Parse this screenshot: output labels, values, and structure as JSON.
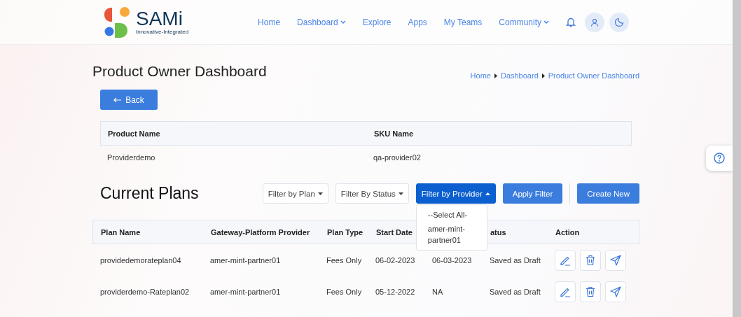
{
  "brand": {
    "name": "SAMi",
    "tagline": "Innovative-Integrated"
  },
  "nav": [
    {
      "label": "Home",
      "dropdown": false
    },
    {
      "label": "Dashboard",
      "dropdown": true
    },
    {
      "label": "Explore",
      "dropdown": false
    },
    {
      "label": "Apps",
      "dropdown": false
    },
    {
      "label": "My Teams",
      "dropdown": false
    },
    {
      "label": "Community",
      "dropdown": true
    }
  ],
  "page_title": "Product Owner Dashboard",
  "breadcrumbs": [
    "Home",
    "Dashboard",
    "Product Owner Dashboard"
  ],
  "back_button": "Back",
  "product_table": {
    "columns": [
      "Product Name",
      "SKU Name"
    ],
    "rows": [
      [
        "Providerdemo",
        "qa-provider02"
      ]
    ]
  },
  "plans": {
    "title": "Current Plans",
    "filters": [
      {
        "label": "Filter by Plan",
        "expanded": false
      },
      {
        "label": "Filter By Status",
        "expanded": false
      },
      {
        "label": "Filter by Provider",
        "expanded": true,
        "options": [
          "--Select All-",
          "amer-mint-partner01"
        ]
      }
    ],
    "buttons": [
      "Apply Filter",
      "Create New"
    ],
    "columns": [
      {
        "label": "Plan Name"
      },
      {
        "label": "Gateway-Platform Provider"
      },
      {
        "label": "Plan Type"
      },
      {
        "label": "Start Date"
      },
      {},
      {
        "label": "atus"
      },
      {
        "label": "Action"
      }
    ],
    "rows": [
      [
        "providedemorateplan04",
        "amer-mint-partner01",
        "Fees Only",
        "06-02-2023",
        "06-03-2023",
        "Saved as Draft"
      ],
      [
        "providerdemo-Rateplan02",
        "amer-mint-partner01",
        "Fees Only",
        "05-12-2022",
        "NA",
        "Saved as Draft"
      ]
    ]
  }
}
